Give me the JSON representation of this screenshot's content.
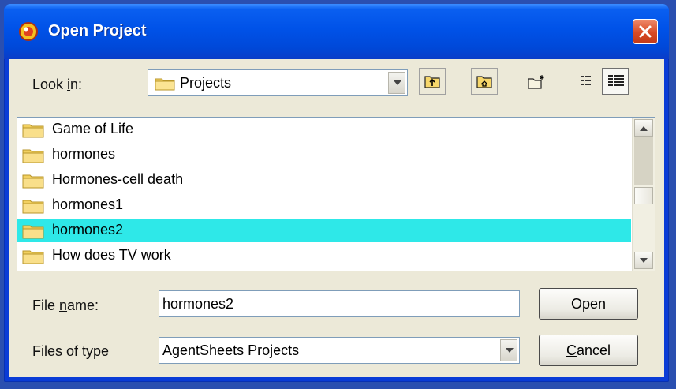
{
  "window": {
    "title": "Open Project"
  },
  "look_in": {
    "label_pre": "Look ",
    "label_key": "i",
    "label_post": "n:",
    "value": "Projects"
  },
  "files": [
    {
      "name": "Game of Life",
      "selected": false
    },
    {
      "name": "hormones",
      "selected": false
    },
    {
      "name": "Hormones-cell death",
      "selected": false
    },
    {
      "name": "hormones1",
      "selected": false
    },
    {
      "name": "hormones2",
      "selected": true
    },
    {
      "name": "How does TV work",
      "selected": false
    }
  ],
  "file_name": {
    "label_pre": "File ",
    "label_key": "n",
    "label_post": "ame:",
    "value": "hormones2"
  },
  "file_type": {
    "label": "Files of type",
    "value": "AgentSheets Projects"
  },
  "buttons": {
    "open": "Open",
    "cancel_key": "C",
    "cancel_rest": "ancel"
  },
  "colors": {
    "selection": "#2ee8e8",
    "titlebar": "#0052e8",
    "close": "#d84a25"
  }
}
